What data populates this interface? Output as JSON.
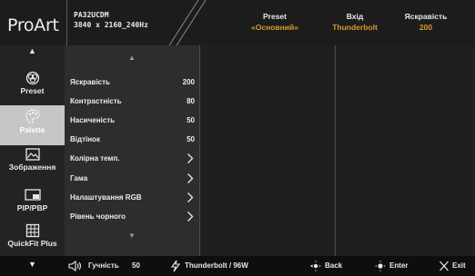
{
  "header": {
    "brand": "ProArt",
    "model_line1": "PA32UCDM",
    "model_line2": "3840 x 2160_240Hz",
    "info": [
      {
        "label": "Preset",
        "value": "«Основний»"
      },
      {
        "label": "Вхід",
        "value": "Thunderbolt"
      },
      {
        "label": "Яскравість",
        "value": "200"
      }
    ]
  },
  "nav": {
    "items": [
      {
        "label": "Preset",
        "icon": "preset-icon",
        "active": false
      },
      {
        "label": "Palette",
        "icon": "palette-icon",
        "active": true
      },
      {
        "label": "Зображення",
        "icon": "image-icon",
        "active": false
      },
      {
        "label": "PIP/PBP",
        "icon": "pip-pbp-icon",
        "active": false
      },
      {
        "label": "QuickFit Plus",
        "icon": "quickfit-icon",
        "active": false
      }
    ]
  },
  "menu": {
    "items": [
      {
        "label": "Яскравість",
        "value": "200"
      },
      {
        "label": "Контрастність",
        "value": "80"
      },
      {
        "label": "Насиченість",
        "value": "50"
      },
      {
        "label": "Відтінок",
        "value": "50"
      },
      {
        "label": "Колірна темп.",
        "value": null
      },
      {
        "label": "Гама",
        "value": null
      },
      {
        "label": "Налаштування RGB",
        "value": null
      },
      {
        "label": "Рівень чорного",
        "value": null
      }
    ]
  },
  "footer": {
    "volume_label": "Гучність",
    "volume_value": "50",
    "power": "Thunderbolt / 96W",
    "back": "Back",
    "enter": "Enter",
    "exit": "Exit"
  },
  "colors": {
    "accent": "#d99a2b",
    "active_nav": "#c6c6c6",
    "panel": "#2d2d2d",
    "header": "#1c1c1c"
  }
}
